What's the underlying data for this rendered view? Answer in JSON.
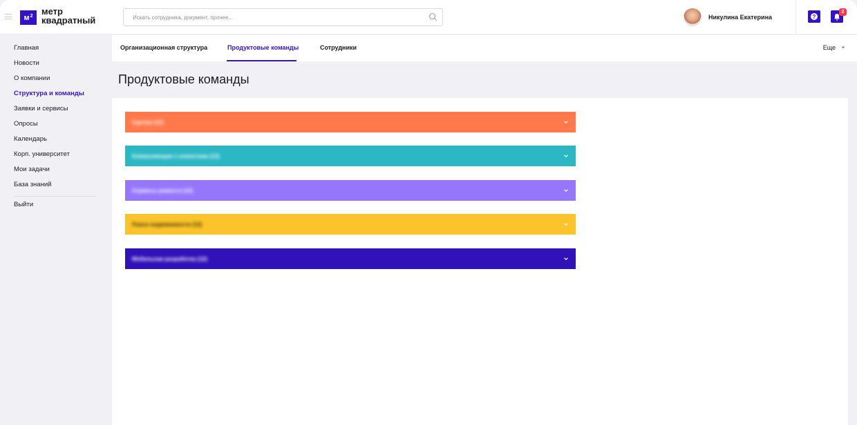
{
  "header": {
    "logo_mark": "м",
    "logo_mark_sup": "2",
    "logo_line1": "метр",
    "logo_line2": "квадратный",
    "search_placeholder": "Искать сотрудника, документ, прочее...",
    "user_name": "Никулина Екатерина",
    "help_label": "?",
    "notification_count": "2"
  },
  "sidebar": {
    "items": [
      {
        "label": "Главная"
      },
      {
        "label": "Новости"
      },
      {
        "label": "О компании"
      },
      {
        "label": "Структура и команды",
        "active": true
      },
      {
        "label": "Заявки и сервисы"
      },
      {
        "label": "Опросы"
      },
      {
        "label": "Календарь"
      },
      {
        "label": "Корп. университет"
      },
      {
        "label": "Мои задачи"
      },
      {
        "label": "База знаний"
      }
    ],
    "logout": "Выйти"
  },
  "tabs": {
    "items": [
      {
        "label": "Организационная структура"
      },
      {
        "label": "Продуктовые команды",
        "active": true
      },
      {
        "label": "Сотрудники"
      }
    ],
    "more_label": "Еще"
  },
  "page": {
    "title": "Продуктовые команды"
  },
  "teams": [
    {
      "label": "Сделки (12)",
      "color": "#ff794c",
      "text_color": "#ffffff"
    },
    {
      "label": "Коммуникации с клиентами (12)",
      "color": "#2bb8c4",
      "text_color": "#ffffff"
    },
    {
      "label": "Сервисы ремонта (12)",
      "color": "#9677fb",
      "text_color": "#ffffff"
    },
    {
      "label": "Поиск недвижимости (12)",
      "color": "#fbc42c",
      "text_color": "#3b2a00"
    },
    {
      "label": "Мобильная разработка (12)",
      "color": "#3012b8",
      "text_color": "#ffffff"
    }
  ],
  "colors": {
    "accent": "#3412c8",
    "badge": "#ff3b47"
  }
}
